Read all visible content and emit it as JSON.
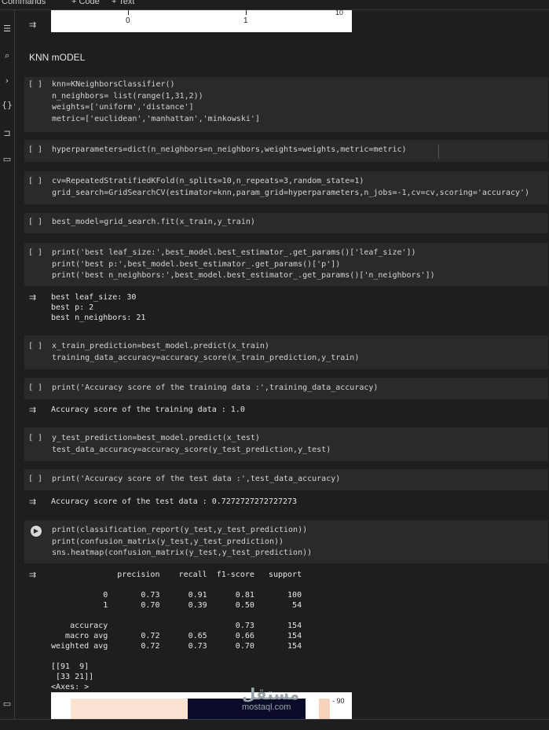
{
  "toolbar": {
    "commands": "Commands",
    "code": "+ Code",
    "text": "+ Text"
  },
  "top_plot": {
    "tick_0": "0",
    "tick_1": "1",
    "colorbar_label": "10"
  },
  "section_heading": "KNN mODEL",
  "cells": [
    {
      "run": "[ ]",
      "lines": [
        "knn=KNeighborsClassifier()",
        "n_neighbors= list(range(1,31,2))",
        "weights=['uniform','distance']",
        "metric=['euclidean','manhattan','minkowski']"
      ]
    },
    {
      "run": "[ ]",
      "lines": [
        "hyperparameters=dict(n_neighbors=n_neighbors,weights=weights,metric=metric)"
      ]
    },
    {
      "run": "[ ]",
      "lines": [
        "cv=RepeatedStratifiedKFold(n_splits=10,n_repeats=3,random_state=1)",
        "grid_search=GridSearchCV(estimator=knn,param_grid=hyperparameters,n_jobs=-1,cv=cv,scoring='accuracy')"
      ]
    },
    {
      "run": "[ ]",
      "lines": [
        "best_model=grid_search.fit(x_train,y_train)"
      ]
    },
    {
      "run": "[ ]",
      "lines": [
        "print('best leaf_size:',best_model.best_estimator_.get_params()['leaf_size'])",
        "print('best p:',best_model.best_estimator_.get_params()['p'])",
        "print('best n_neighbors:',best_model.best_estimator_.get_params()['n_neighbors'])"
      ]
    },
    {
      "run": "[ ]",
      "lines": [
        "x_train_prediction=best_model.predict(x_train)",
        "training_data_accuracy=accuracy_score(x_train_prediction,y_train)"
      ]
    },
    {
      "run": "[ ]",
      "lines": [
        "print('Accuracy score of the training data :',training_data_accuracy)"
      ]
    },
    {
      "run": "[ ]",
      "lines": [
        "y_test_prediction=best_model.predict(x_test)",
        "test_data_accuracy=accuracy_score(y_test_prediction,y_test)"
      ]
    },
    {
      "run": "[ ]",
      "lines": [
        "print('Accuracy score of the test data :',test_data_accuracy)"
      ]
    },
    {
      "run": "",
      "lines": [
        "print(classification_report(y_test,y_test_prediction))",
        "print(confusion_matrix(y_test,y_test_prediction))",
        "sns.heatmap(confusion_matrix(y_test,y_test_prediction))"
      ]
    }
  ],
  "outputs": {
    "best_params": "best leaf_size: 30\nbest p: 2\nbest n_neighbors: 21",
    "train_acc": "Accuracy score of the training data : 1.0",
    "test_acc": "Accuracy score of the test data : 0.7272727272727273",
    "report": "              precision    recall  f1-score   support\n\n           0       0.73      0.91      0.81       100\n           1       0.70      0.39      0.50        54\n\n    accuracy                           0.73       154\n   macro avg       0.72      0.65      0.66       154\nweighted avg       0.72      0.73      0.70       154\n\n[[91  9]\n [33 21]]\n<Axes: >"
  },
  "bottom_plot": {
    "colorbar_label": "- 90"
  },
  "watermark": {
    "arabic": "مستقل",
    "latin": "mostaql.com"
  }
}
